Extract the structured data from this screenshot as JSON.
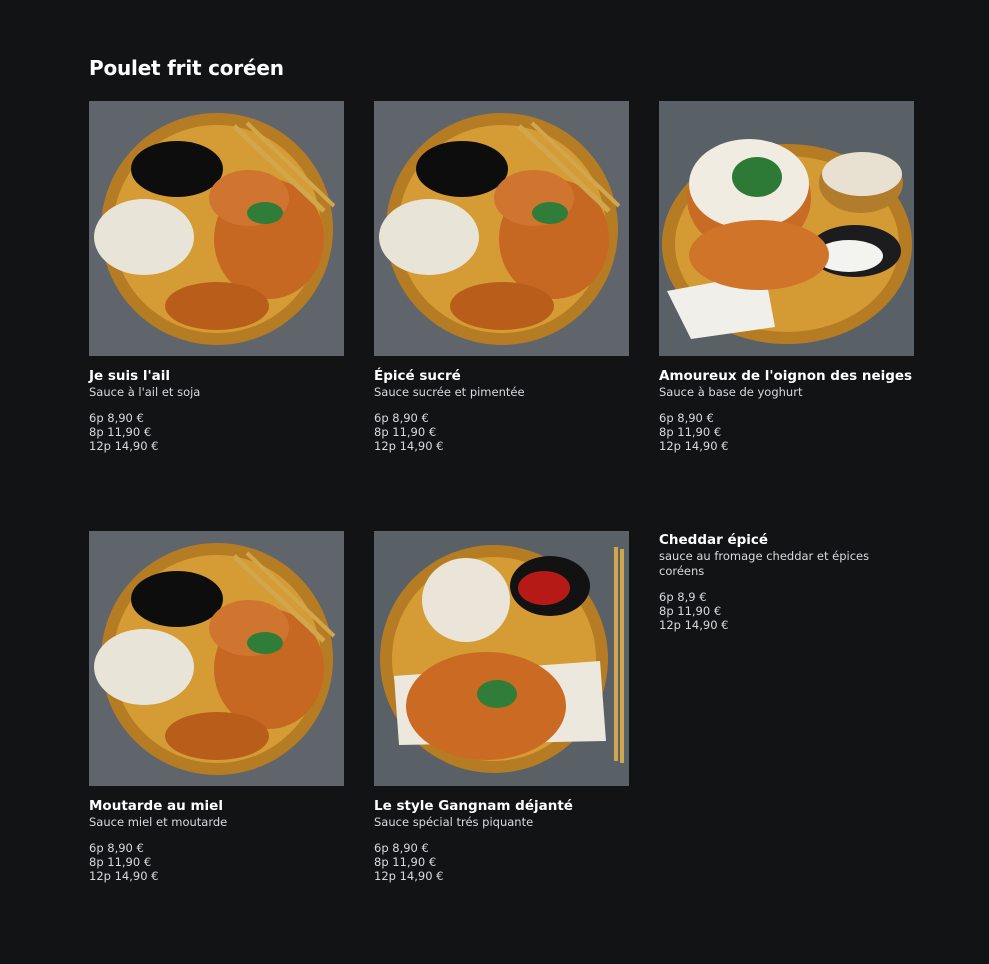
{
  "page": {
    "title": "Poulet frit coréen"
  },
  "colors": {
    "background": "#111315",
    "title": "#ffffff",
    "text": "#d8dadd",
    "plate": "#c08a2a",
    "chicken": "#c96a1f"
  },
  "items": [
    {
      "name": "Je suis l'ail",
      "description": "Sauce à l'ail et soja",
      "prices": [
        "6p 8,90 €",
        "8p 11,90 €",
        "12p 14,90 €"
      ],
      "image": "garlic-soy-chicken-image"
    },
    {
      "name": "Épicé sucré",
      "description": "Sauce sucrée et pimentée",
      "prices": [
        "6p 8,90 €",
        "8p 11,90 €",
        "12p 14,90 €"
      ],
      "image": "sweet-spicy-chicken-image"
    },
    {
      "name": "Amoureux de l'oignon des neiges",
      "description": "Sauce à base de yoghurt",
      "prices": [
        "6p 8,90 €",
        "8p 11,90 €",
        "12p 14,90 €"
      ],
      "image": "snow-onion-chicken-image"
    },
    {
      "name": "Moutarde au miel",
      "description": "Sauce miel et moutarde",
      "prices": [
        "6p 8,90 €",
        "8p 11,90 €",
        "12p 14,90 €"
      ],
      "image": "honey-mustard-chicken-image"
    },
    {
      "name": "Le style Gangnam déjanté",
      "description": "Sauce spécial trés piquante",
      "prices": [
        "6p 8,90 €",
        "8p 11,90 €",
        "12p 14,90 €"
      ],
      "image": "gangnam-style-chicken-image"
    },
    {
      "name": "Cheddar épicé",
      "description": "sauce au fromage cheddar et épices coréens",
      "prices": [
        "6p 8,9 €",
        "8p 11,90 €",
        "12p 14,90 €"
      ]
    }
  ]
}
